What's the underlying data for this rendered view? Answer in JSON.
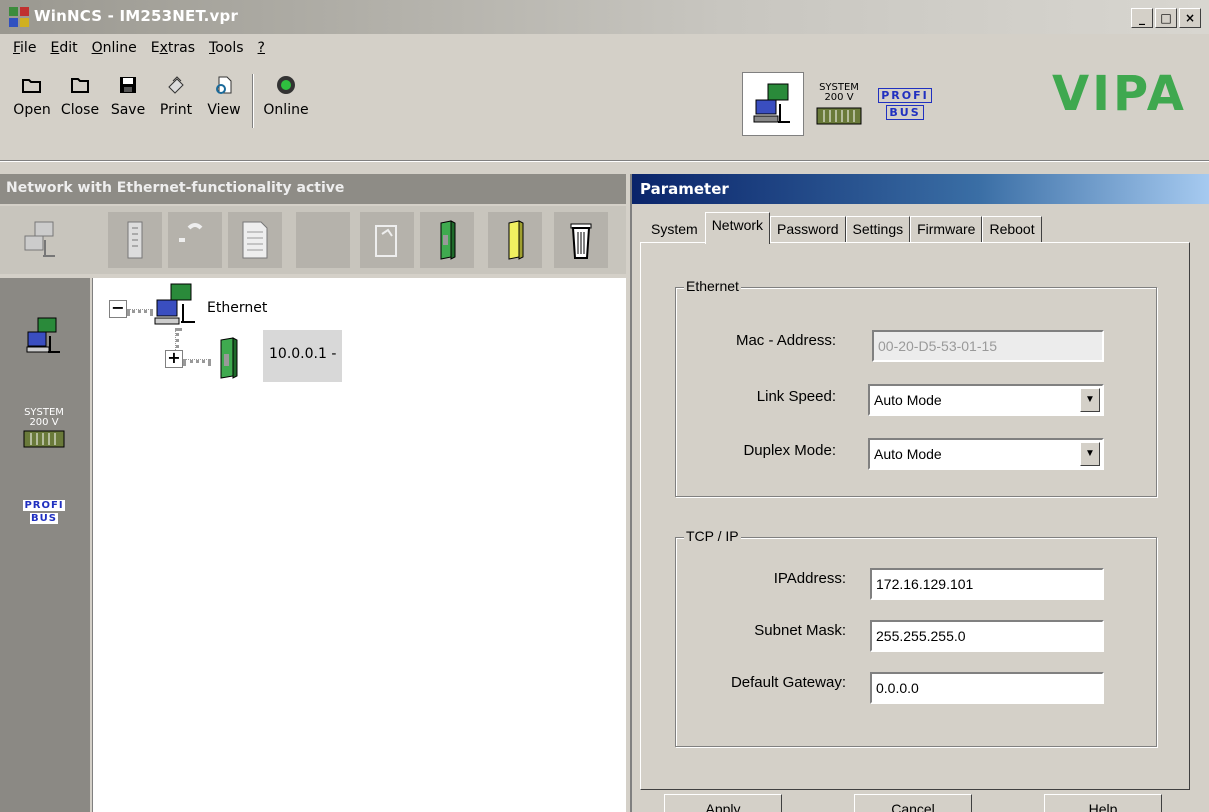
{
  "window": {
    "title": "WinNCS - IM253NET.vpr",
    "controls": [
      "_",
      "□",
      "×"
    ]
  },
  "menu": [
    {
      "label": "File",
      "ul": "F"
    },
    {
      "label": "Edit",
      "ul": "E"
    },
    {
      "label": "Online",
      "ul": "O"
    },
    {
      "label": "Extras",
      "ul": "x"
    },
    {
      "label": "Tools",
      "ul": "T"
    },
    {
      "label": "?",
      "ul": "?"
    }
  ],
  "toolbar": {
    "open": "Open",
    "close": "Close",
    "save": "Save",
    "print": "Print",
    "view": "View",
    "online": "Online"
  },
  "brand": {
    "logo": "VIPA",
    "system_label_1": "SYSTEM",
    "system_label_2": "200 V",
    "profibus_label_1": "PROFI",
    "profibus_label_2": "BUS",
    "accent_color": "#3fa84f"
  },
  "left_panel": {
    "header": "Network with Ethernet-functionality active",
    "side_system_1": "SYSTEM",
    "side_system_2": "200 V",
    "side_profi_1": "PROFI",
    "side_profi_2": "BUS",
    "tree": {
      "root_label": "Ethernet",
      "root_expander": "−",
      "child_label": "10.0.0.1 -",
      "child_expander": "+"
    }
  },
  "right_panel": {
    "header": "Parameter",
    "tabs": [
      "System",
      "Network",
      "Password",
      "Settings",
      "Firmware",
      "Reboot"
    ],
    "active_tab": "Network",
    "ethernet_group": {
      "title": "Ethernet",
      "mac_label": "Mac - Address:",
      "mac_value": "00-20-D5-53-01-15",
      "link_speed_label": "Link Speed:",
      "link_speed_value": "Auto Mode",
      "duplex_label": "Duplex Mode:",
      "duplex_value": "Auto Mode"
    },
    "tcpip_group": {
      "title": "TCP / IP",
      "ip_label": "IPAddress:",
      "ip_value": "172.16.129.101",
      "subnet_label": "Subnet Mask:",
      "subnet_value": "255.255.255.0",
      "gateway_label": "Default Gateway:",
      "gateway_value": "0.0.0.0"
    },
    "buttons": {
      "apply": "Apply",
      "cancel": "Cancel",
      "help": "Help"
    }
  }
}
